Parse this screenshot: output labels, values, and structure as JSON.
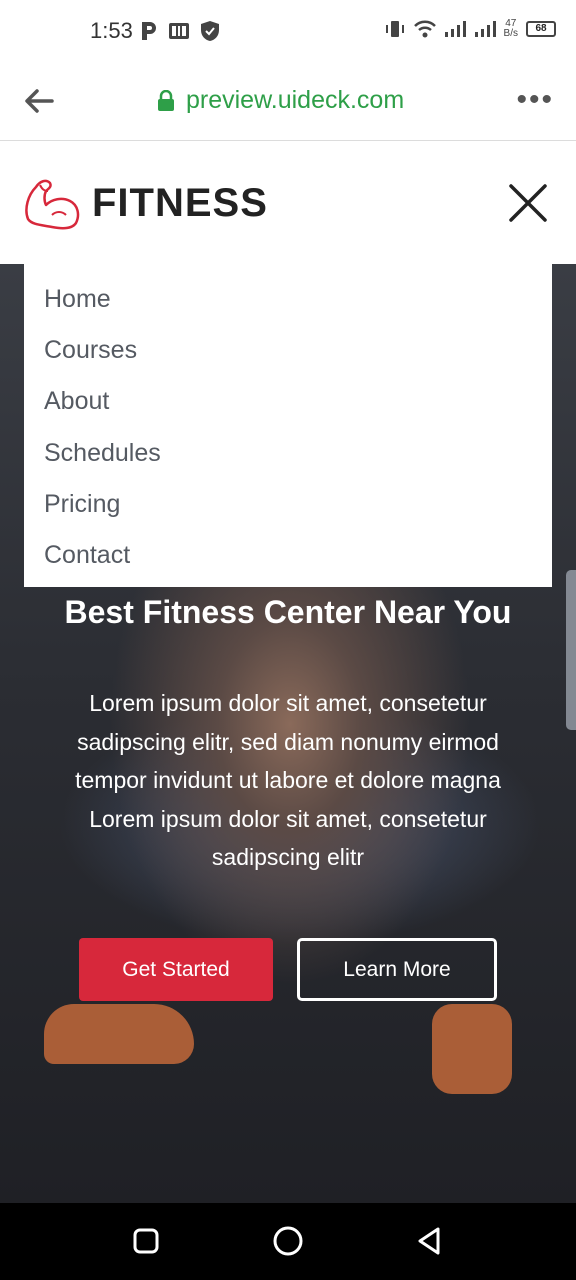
{
  "status_bar": {
    "time": "1:53",
    "left_icons": [
      "parking-icon",
      "news-icon",
      "shield-icon"
    ],
    "network_rate_value": "47",
    "network_rate_unit": "B/s",
    "battery": "68"
  },
  "browser": {
    "url": "preview.uideck.com"
  },
  "site": {
    "logo_text": "FITNESS",
    "brand_color": "#d7283b"
  },
  "menu": {
    "items": [
      {
        "label": "Home"
      },
      {
        "label": "Courses"
      },
      {
        "label": "About"
      },
      {
        "label": "Schedules"
      },
      {
        "label": "Pricing"
      },
      {
        "label": "Contact"
      }
    ]
  },
  "hero": {
    "title": "Best Fitness Center Near You",
    "description": "Lorem ipsum dolor sit amet, consetetur sadipscing elitr, sed diam nonumy eirmod tempor invidunt ut labore et dolore magna Lorem ipsum dolor sit amet, consetetur sadipscing elitr",
    "primary_button": "Get Started",
    "secondary_button": "Learn More"
  }
}
